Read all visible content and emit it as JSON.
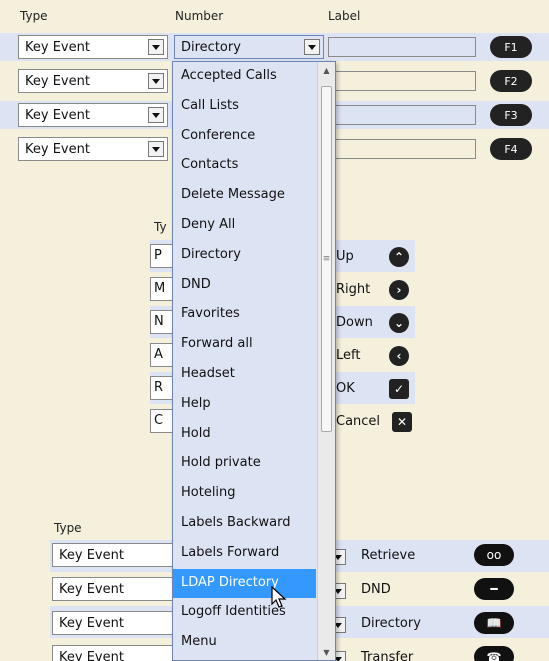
{
  "headers": {
    "type": "Type",
    "number": "Number",
    "label": "Label"
  },
  "key_rows": [
    {
      "type": "Key Event",
      "number": "Directory",
      "label": "",
      "fkey": "F1"
    },
    {
      "type": "Key Event",
      "number": "",
      "label": "",
      "fkey": "F2"
    },
    {
      "type": "Key Event",
      "number": "",
      "label": "",
      "fkey": "F3"
    },
    {
      "type": "Key Event",
      "number": "",
      "label": "",
      "fkey": "F4"
    }
  ],
  "nav_section": {
    "type_header_fragment": "Ty",
    "fragments": [
      "P",
      "M",
      "N",
      "A",
      "R",
      "C"
    ],
    "keys": [
      {
        "label": "Up",
        "icon": "chevron-up-icon",
        "glyph": "⌃"
      },
      {
        "label": "Right",
        "icon": "chevron-right-icon",
        "glyph": "›"
      },
      {
        "label": "Down",
        "icon": "chevron-down-icon",
        "glyph": "⌄"
      },
      {
        "label": "Left",
        "icon": "chevron-left-icon",
        "glyph": "‹"
      },
      {
        "label": "OK",
        "icon": "check-icon",
        "glyph": "✓"
      },
      {
        "label": "Cancel",
        "icon": "close-icon",
        "glyph": "✕"
      }
    ]
  },
  "bottom_section": {
    "type_header": "Type",
    "rows": [
      {
        "type": "Key Event",
        "label": "Retrieve",
        "icon": "voicemail-icon",
        "glyph": "oo"
      },
      {
        "type": "Key Event",
        "label": "DND",
        "icon": "do-not-disturb-icon",
        "glyph": "━"
      },
      {
        "type": "Key Event",
        "label": "Directory",
        "icon": "book-icon",
        "glyph": "📖"
      },
      {
        "type": "Key Event",
        "label": "Transfer",
        "icon": "transfer-icon",
        "glyph": "☎"
      }
    ]
  },
  "dropdown": {
    "options": [
      "Accepted Calls",
      "Call Lists",
      "Conference",
      "Contacts",
      "Delete Message",
      "Deny All",
      "Directory",
      "DND",
      "Favorites",
      "Forward all",
      "Headset",
      "Help",
      "Hold",
      "Hold private",
      "Hoteling",
      "Labels Backward",
      "Labels Forward",
      "LDAP Directory",
      "Logoff Identities",
      "Menu"
    ],
    "highlighted": "LDAP Directory"
  },
  "colors": {
    "background": "#f5f0dc",
    "row_highlight": "#dce4f4",
    "selection": "#3399ff",
    "key_pill": "#222222"
  }
}
